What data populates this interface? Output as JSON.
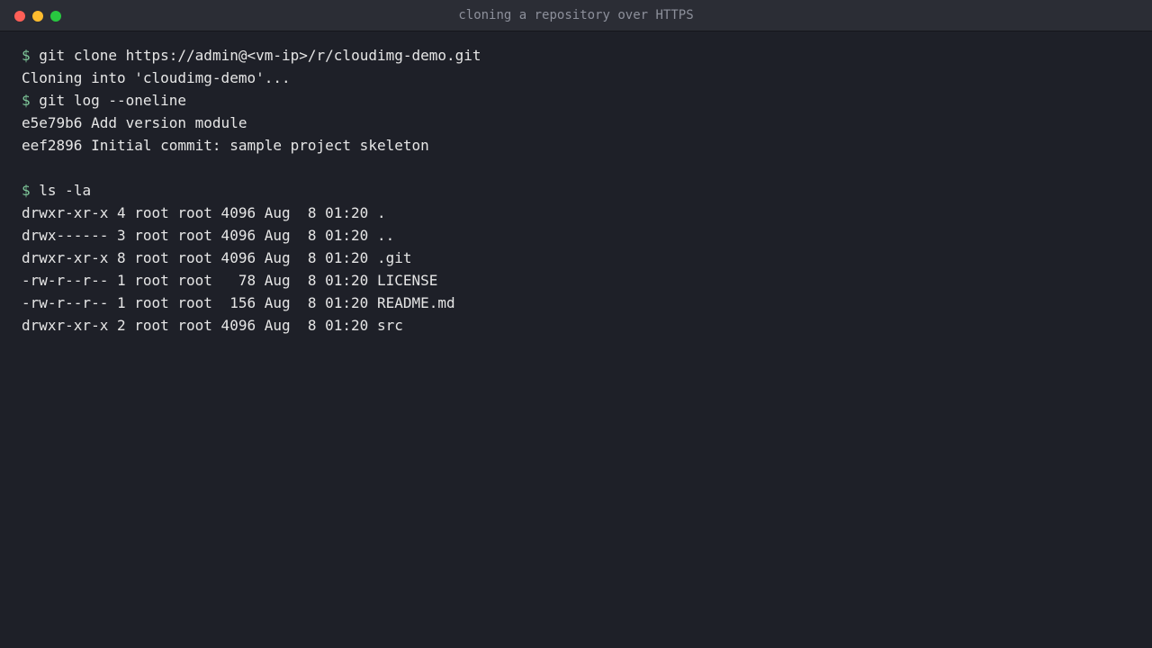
{
  "window": {
    "title": "cloning a repository over HTTPS"
  },
  "colors": {
    "background": "#1e2028",
    "titlebar": "#2b2d35",
    "text": "#e6e6e6",
    "prompt": "#7ec699",
    "close": "#ff5f57",
    "minimize": "#febc2e",
    "maximize": "#28c840"
  },
  "terminal": {
    "prompt_symbol": "$",
    "lines": [
      {
        "type": "command",
        "text": "git clone https://admin@<vm-ip>/r/cloudimg-demo.git"
      },
      {
        "type": "output",
        "text": "Cloning into 'cloudimg-demo'..."
      },
      {
        "type": "command",
        "text": "git log --oneline"
      },
      {
        "type": "output",
        "text": "e5e79b6 Add version module"
      },
      {
        "type": "output",
        "text": "eef2896 Initial commit: sample project skeleton"
      },
      {
        "type": "blank",
        "text": ""
      },
      {
        "type": "command",
        "text": "ls -la"
      },
      {
        "type": "output",
        "text": "drwxr-xr-x 4 root root 4096 Aug  8 01:20 ."
      },
      {
        "type": "output",
        "text": "drwx------ 3 root root 4096 Aug  8 01:20 .."
      },
      {
        "type": "output",
        "text": "drwxr-xr-x 8 root root 4096 Aug  8 01:20 .git"
      },
      {
        "type": "output",
        "text": "-rw-r--r-- 1 root root   78 Aug  8 01:20 LICENSE"
      },
      {
        "type": "output",
        "text": "-rw-r--r-- 1 root root  156 Aug  8 01:20 README.md"
      },
      {
        "type": "output",
        "text": "drwxr-xr-x 2 root root 4096 Aug  8 01:20 src"
      }
    ]
  }
}
